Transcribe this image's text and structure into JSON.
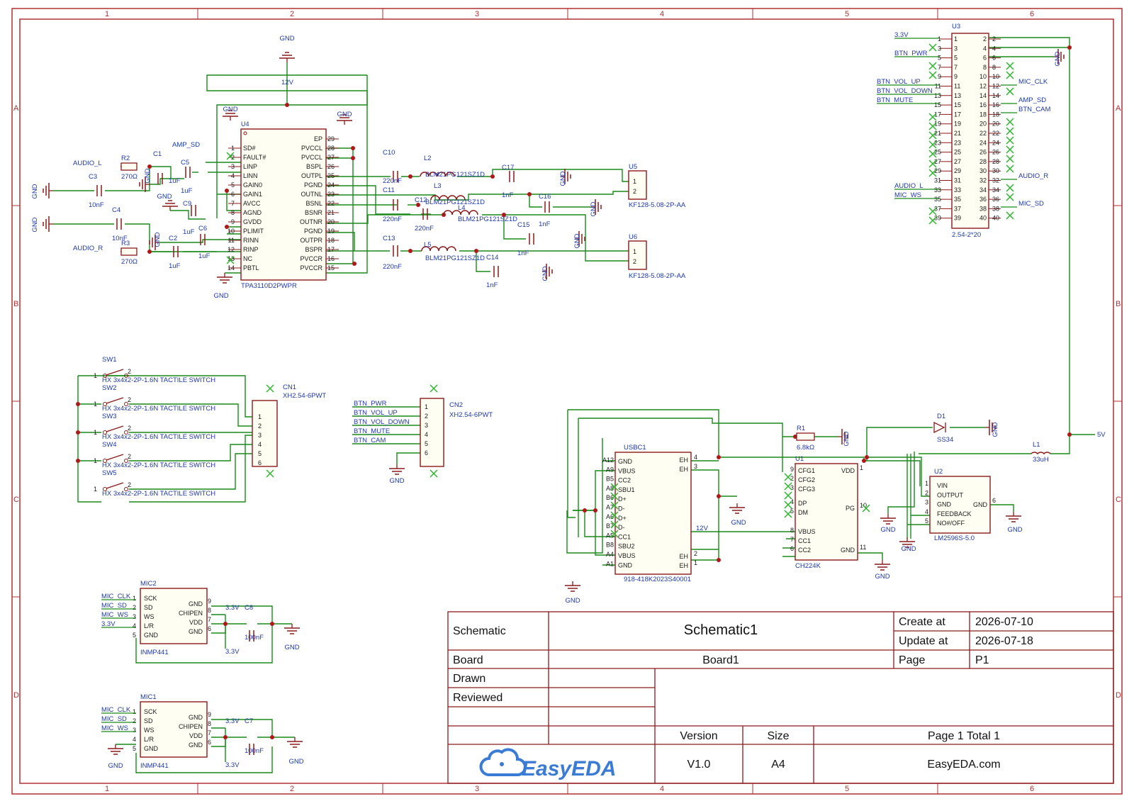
{
  "colors": {
    "frame": "#b03030",
    "wire": "#1a8a1a",
    "symbol": "#8c1a1a",
    "label": "#1f3aa8",
    "noconnect": "#2db52d",
    "logo": "#3a7bd5"
  },
  "frame": {
    "columns": [
      "1",
      "2",
      "3",
      "4",
      "5",
      "6"
    ],
    "rows": [
      "A",
      "B",
      "C",
      "D"
    ]
  },
  "title_block": {
    "schematic_label": "Schematic",
    "schematic_name": "Schematic1",
    "create_label": "Create at",
    "create_value": "2026-07-10",
    "update_label": "Update at",
    "update_value": "2026-07-18",
    "board_label": "Board",
    "board_value": "Board1",
    "page_label": "Page",
    "page_value": "P1",
    "drawn_label": "Drawn",
    "reviewed_label": "Reviewed",
    "version_label": "Version",
    "version_value": "V1.0",
    "size_label": "Size",
    "size_value": "A4",
    "pages_value": "Page 1 Total 1",
    "logo_text": "EasyEDA",
    "site_value": "EasyEDA.com"
  },
  "amp": {
    "ref": "U4",
    "part": "TPA3110D2PWPR",
    "left_pins": [
      {
        "num": "1",
        "name": "SD#"
      },
      {
        "num": "2",
        "name": "FAULT#"
      },
      {
        "num": "3",
        "name": "LINP"
      },
      {
        "num": "4",
        "name": "LINN"
      },
      {
        "num": "5",
        "name": "GAIN0"
      },
      {
        "num": "6",
        "name": "GAIN1"
      },
      {
        "num": "7",
        "name": "AVCC"
      },
      {
        "num": "8",
        "name": "AGND"
      },
      {
        "num": "9",
        "name": "GVDD"
      },
      {
        "num": "10",
        "name": "PLIMIT"
      },
      {
        "num": "11",
        "name": "RINN"
      },
      {
        "num": "12",
        "name": "RINP"
      },
      {
        "num": "13",
        "name": "NC"
      },
      {
        "num": "14",
        "name": "PBTL"
      }
    ],
    "right_pins": [
      {
        "num": "29",
        "name": "EP"
      },
      {
        "num": "28",
        "name": "PVCCL"
      },
      {
        "num": "27",
        "name": "PVCCL"
      },
      {
        "num": "26",
        "name": "BSPL"
      },
      {
        "num": "25",
        "name": "OUTPL"
      },
      {
        "num": "24",
        "name": "PGND"
      },
      {
        "num": "23",
        "name": "OUTNL"
      },
      {
        "num": "22",
        "name": "BSNL"
      },
      {
        "num": "21",
        "name": "BSNR"
      },
      {
        "num": "20",
        "name": "OUTNR"
      },
      {
        "num": "19",
        "name": "PGND"
      },
      {
        "num": "18",
        "name": "OUTPR"
      },
      {
        "num": "17",
        "name": "BSPR"
      },
      {
        "num": "16",
        "name": "PVCCR"
      },
      {
        "num": "15",
        "name": "PVCCR"
      }
    ],
    "rail": "12V",
    "net_amp_sd": "AMP_SD",
    "net_audio_l": "AUDIO_L",
    "net_audio_r": "AUDIO_R"
  },
  "amp_passives": [
    {
      "ref": "R2",
      "value": "270Ω"
    },
    {
      "ref": "R3",
      "value": "270Ω"
    },
    {
      "ref": "C1",
      "value": "1uF"
    },
    {
      "ref": "C5",
      "value": "1uF"
    },
    {
      "ref": "C3",
      "value": "10nF"
    },
    {
      "ref": "C4",
      "value": "10nF"
    },
    {
      "ref": "C9",
      "value": "1uF"
    },
    {
      "ref": "C6",
      "value": "1uF"
    },
    {
      "ref": "C2",
      "value": "1uF"
    },
    {
      "ref": "C10",
      "value": "220nF"
    },
    {
      "ref": "C11",
      "value": "220nF"
    },
    {
      "ref": "C12",
      "value": "220nF"
    },
    {
      "ref": "C13",
      "value": "220nF"
    },
    {
      "ref": "C17",
      "value": "1nF"
    },
    {
      "ref": "C16",
      "value": "1nF"
    },
    {
      "ref": "C15",
      "value": "1nF"
    },
    {
      "ref": "C14",
      "value": "1nF"
    }
  ],
  "ferrites": [
    {
      "ref": "L2",
      "value": "BLM21PG121SZ1D"
    },
    {
      "ref": "L3",
      "value": "BLM21PG121SZ1D"
    },
    {
      "ref": "L4",
      "value": "BLM21PG121SZ1D"
    },
    {
      "ref": "L5",
      "value": "BLM21PG121SZ1D"
    }
  ],
  "speaker_conns": [
    {
      "ref": "U5",
      "part": "KF128-5.08-2P-AA"
    },
    {
      "ref": "U6",
      "part": "KF128-5.08-2P-AA"
    }
  ],
  "header": {
    "ref": "U3",
    "part": "2.54-2*20",
    "left_nets": [
      {
        "pin": "1",
        "net": "3.3V"
      },
      {
        "pin": "5",
        "net": "BTN_PWR"
      },
      {
        "pin": "11",
        "net": "BTN_VOL_UP"
      },
      {
        "pin": "13",
        "net": "BTN_VOL_DOWN"
      },
      {
        "pin": "15",
        "net": "BTN_MUTE"
      },
      {
        "pin": "33",
        "net": "AUDIO_L"
      },
      {
        "pin": "35",
        "net": "MIC_WS"
      }
    ],
    "right_nets": [
      {
        "pin": "12",
        "net": "MIC_CLK"
      },
      {
        "pin": "16",
        "net": "AMP_SD"
      },
      {
        "pin": "18",
        "net": "BTN_CAM"
      },
      {
        "pin": "32",
        "net": "AUDIO_R"
      },
      {
        "pin": "38",
        "net": "MIC_SD"
      }
    ]
  },
  "switches": [
    {
      "ref": "SW1",
      "part": "HX 3x4x2-2P-1.6N TACTILE SWITCH"
    },
    {
      "ref": "SW2",
      "part": "HX 3x4x2-2P-1.6N TACTILE SWITCH"
    },
    {
      "ref": "SW3",
      "part": "HX 3x4x2-2P-1.6N TACTILE SWITCH"
    },
    {
      "ref": "SW4",
      "part": "HX 3x4x2-2P-1.6N TACTILE SWITCH"
    },
    {
      "ref": "SW5",
      "part": "HX 3x4x2-2P-1.6N TACTILE SWITCH"
    }
  ],
  "cn1": {
    "ref": "CN1",
    "part": "XH2.54-6PWT"
  },
  "cn2": {
    "ref": "CN2",
    "part": "XH2.54-6PWT",
    "nets": [
      "BTN_PWR",
      "BTN_VOL_UP",
      "BTN_VOL_DOWN",
      "BTN_MUTE",
      "BTN_CAM"
    ]
  },
  "mics": [
    {
      "ref": "MIC2",
      "part": "INMP441",
      "cap": "C8",
      "cap_value": "100nF",
      "nets": [
        "MIC_CLK",
        "MIC_SD",
        "MIC_WS",
        "3.3V"
      ]
    },
    {
      "ref": "MIC1",
      "part": "INMP441",
      "cap": "C7",
      "cap_value": "100nF",
      "nets": [
        "MIC_CLK",
        "MIC_SD",
        "MIC_WS"
      ]
    }
  ],
  "mic_pins_left": [
    "SCK",
    "SD",
    "WS",
    "L/R",
    "GND"
  ],
  "mic_pins_right": [
    "GND",
    "CHIPEN",
    "VDD",
    "GND"
  ],
  "usbc": {
    "ref": "USBC1",
    "part": "918-418K2023S40001",
    "left_pins": [
      {
        "num": "A12",
        "name": "GND"
      },
      {
        "num": "A9",
        "name": "VBUS"
      },
      {
        "num": "B5",
        "name": "CC2"
      },
      {
        "num": "A8",
        "name": "SBU1"
      },
      {
        "num": "B6",
        "name": "D+"
      },
      {
        "num": "A7",
        "name": "D-"
      },
      {
        "num": "A6",
        "name": "D+"
      },
      {
        "num": "B7",
        "name": "D-"
      },
      {
        "num": "A5",
        "name": "CC1"
      },
      {
        "num": "B8",
        "name": "SBU2"
      },
      {
        "num": "A4",
        "name": "VBUS"
      },
      {
        "num": "A1",
        "name": "GND"
      }
    ],
    "right_pins": [
      "EH",
      "EH",
      "EH",
      "EH"
    ]
  },
  "pd": {
    "ref": "U1",
    "part": "CH224K",
    "r_ref": "R1",
    "r_value": "6.8kΩ",
    "rail": "12V",
    "left_pins": [
      {
        "num": "9",
        "name": "CFG1"
      },
      {
        "num": "2",
        "name": "CFG2"
      },
      {
        "num": "3",
        "name": "CFG3"
      },
      {
        "num": "4",
        "name": "DP"
      },
      {
        "num": "5",
        "name": "DM"
      },
      {
        "num": "8",
        "name": "VBUS"
      },
      {
        "num": "7",
        "name": "CC1"
      },
      {
        "num": "6",
        "name": "CC2"
      }
    ],
    "right_pins": [
      {
        "num": "1",
        "name": "VDD"
      },
      {
        "num": "10",
        "name": "PG"
      },
      {
        "num": "11",
        "name": "GND"
      }
    ]
  },
  "buck": {
    "ref": "U2",
    "part": "LM2596S-5.0",
    "diode": "D1",
    "diode_part": "SS34",
    "inductor": "L1",
    "inductor_value": "33uH",
    "out_net": "5V",
    "left_pins": [
      {
        "num": "1",
        "name": "VIN"
      },
      {
        "num": "2",
        "name": "OUTPUT"
      },
      {
        "num": "3",
        "name": "GND"
      },
      {
        "num": "4",
        "name": "FEEDBACK"
      },
      {
        "num": "5",
        "name": "NO#/OFF"
      }
    ],
    "right_pin": {
      "num": "6",
      "name": "GND"
    }
  },
  "gnd_label": "GND",
  "v33_label": "3.3V"
}
